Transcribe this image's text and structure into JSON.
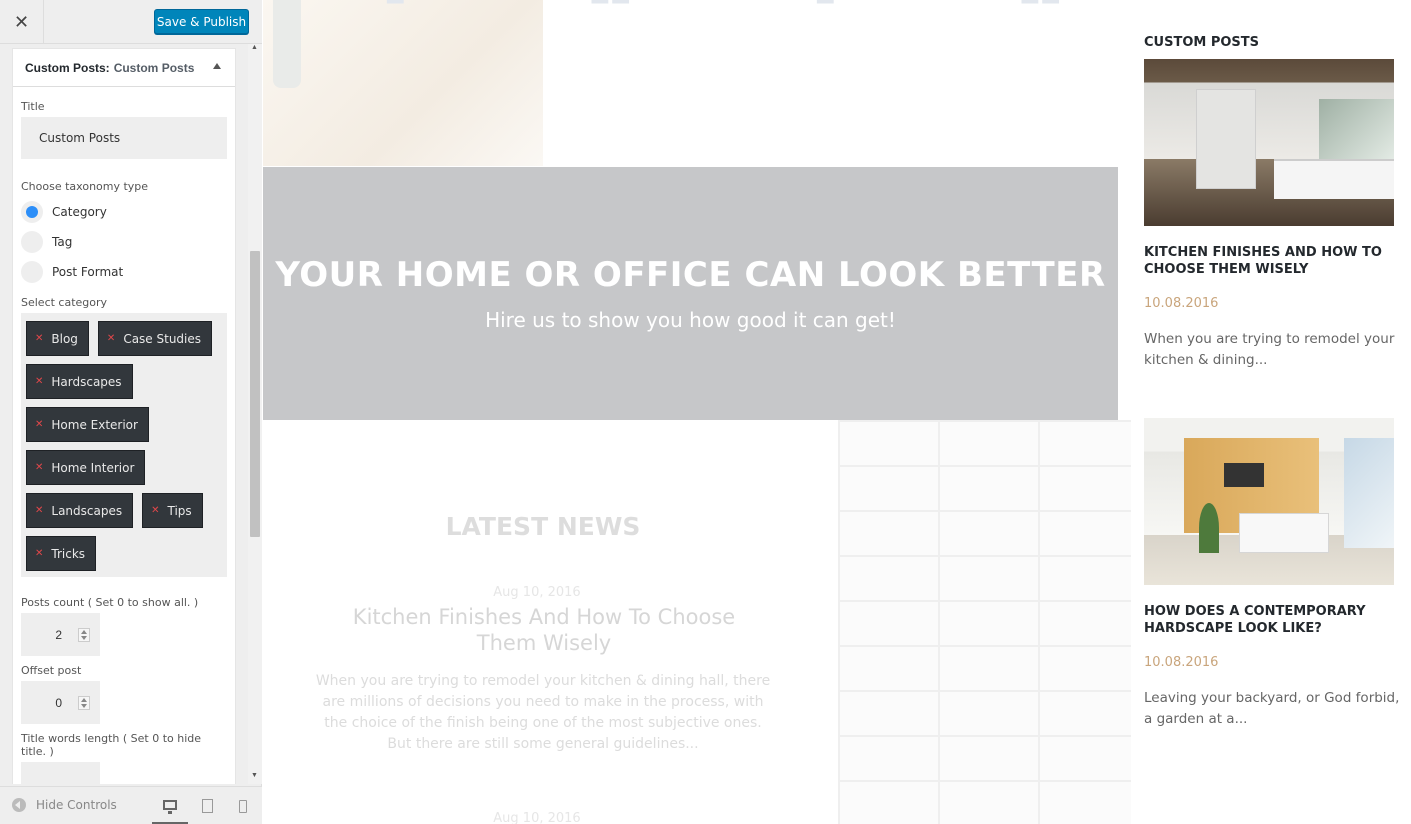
{
  "header": {
    "close_icon": "close-icon",
    "publish_label": "Save & Publish"
  },
  "section": {
    "title": "Custom Posts:",
    "subtitle": "Custom Posts"
  },
  "fields": {
    "title_label": "Title",
    "title_value": "Custom Posts",
    "taxonomy_label": "Choose taxonomy type",
    "taxonomy_options": [
      {
        "label": "Category",
        "selected": true
      },
      {
        "label": "Tag",
        "selected": false
      },
      {
        "label": "Post Format",
        "selected": false
      }
    ],
    "category_label": "Select category",
    "categories": [
      "Blog",
      "Case Studies",
      "Hardscapes",
      "Home Exterior",
      "Home Interior",
      "Landscapes",
      "Tips",
      "Tricks"
    ],
    "posts_count_label": "Posts count ( Set 0 to show all. )",
    "posts_count_value": "2",
    "offset_label": "Offset post",
    "offset_value": "0",
    "title_words_label": "Title words length ( Set 0 to hide title. )"
  },
  "footer": {
    "hide_controls": "Hide Controls",
    "devices": [
      "desktop",
      "tablet",
      "mobile"
    ],
    "active_device": "desktop"
  },
  "preview": {
    "hero_title": "YOUR HOME OR OFFICE CAN LOOK BETTER",
    "hero_subtitle": "Hire us to show you how good it can get!",
    "news_section_title": "LATEST NEWS",
    "news_date": "Aug 10, 2016",
    "news_headline": "Kitchen Finishes And How To Choose Them Wisely",
    "news_excerpt": "When you are trying to remodel your kitchen & dining hall, there are millions of decisions you need to make in the process, with the choice of the finish being one of the most subjective ones. But there are still some general guidelines...",
    "news_date_2": "Aug 10, 2016",
    "widget_title": "CUSTOM POSTS",
    "widget_posts": [
      {
        "title": "KITCHEN FINISHES AND HOW TO CHOOSE THEM WISELY",
        "date": "10.08.2016",
        "excerpt": "When you are trying to remodel your kitchen & dining..."
      },
      {
        "title": "HOW DOES A CONTEMPORARY HARDSCAPE LOOK LIKE?",
        "date": "10.08.2016",
        "excerpt": "Leaving your backyard, or God forbid, a garden at a..."
      }
    ]
  }
}
